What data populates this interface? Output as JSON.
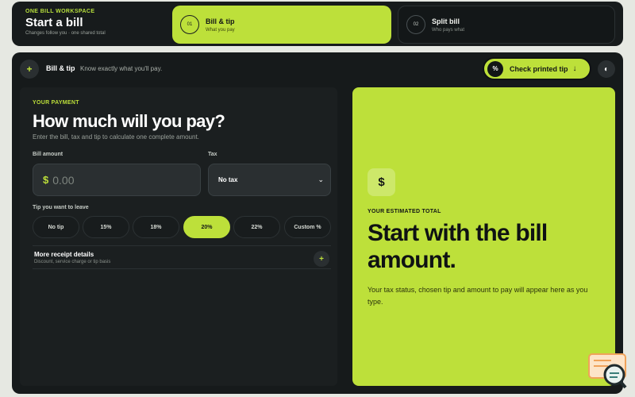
{
  "brand": {
    "kicker": "ONE BILL WORKSPACE",
    "title": "Start a bill",
    "subtitle": "Changes follow you · one shared total"
  },
  "steps": [
    {
      "number": "01",
      "title": "Bill & tip",
      "subtitle": "What you pay",
      "active": true
    },
    {
      "number": "02",
      "title": "Split bill",
      "subtitle": "Who pays what",
      "active": false
    }
  ],
  "topbar": {
    "add_icon": "+",
    "title": "Bill & tip",
    "description": "Know exactly what you'll pay.",
    "check_button": {
      "icon": "%",
      "label": "Check printed tip",
      "arrow": "↓"
    },
    "theme_icon": "◐"
  },
  "payment": {
    "kicker": "YOUR PAYMENT",
    "title": "How much will you pay?",
    "description": "Enter the bill, tax and tip to calculate one complete amount.",
    "bill_amount_label": "Bill amount",
    "currency_symbol": "$",
    "bill_amount_placeholder": "0.00",
    "tax_label": "Tax",
    "tax_value": "No tax",
    "tip_label": "Tip you want to leave",
    "tip_options": [
      {
        "label": "No tip",
        "selected": false
      },
      {
        "label": "15%",
        "selected": false
      },
      {
        "label": "18%",
        "selected": false
      },
      {
        "label": "20%",
        "selected": true
      },
      {
        "label": "22%",
        "selected": false
      },
      {
        "label": "Custom %",
        "selected": false
      }
    ],
    "more_details_title": "More receipt details",
    "more_details_subtitle": "Discount, service charge or tip basis",
    "more_details_icon": "+"
  },
  "total": {
    "icon": "$",
    "kicker": "YOUR ESTIMATED TOTAL",
    "title": "Start with the bill amount.",
    "description": "Your tax status, chosen tip and amount to pay will appear here as you type."
  },
  "colors": {
    "accent": "#bde03a",
    "background": "#161a1b",
    "panel": "#1b1f20"
  }
}
